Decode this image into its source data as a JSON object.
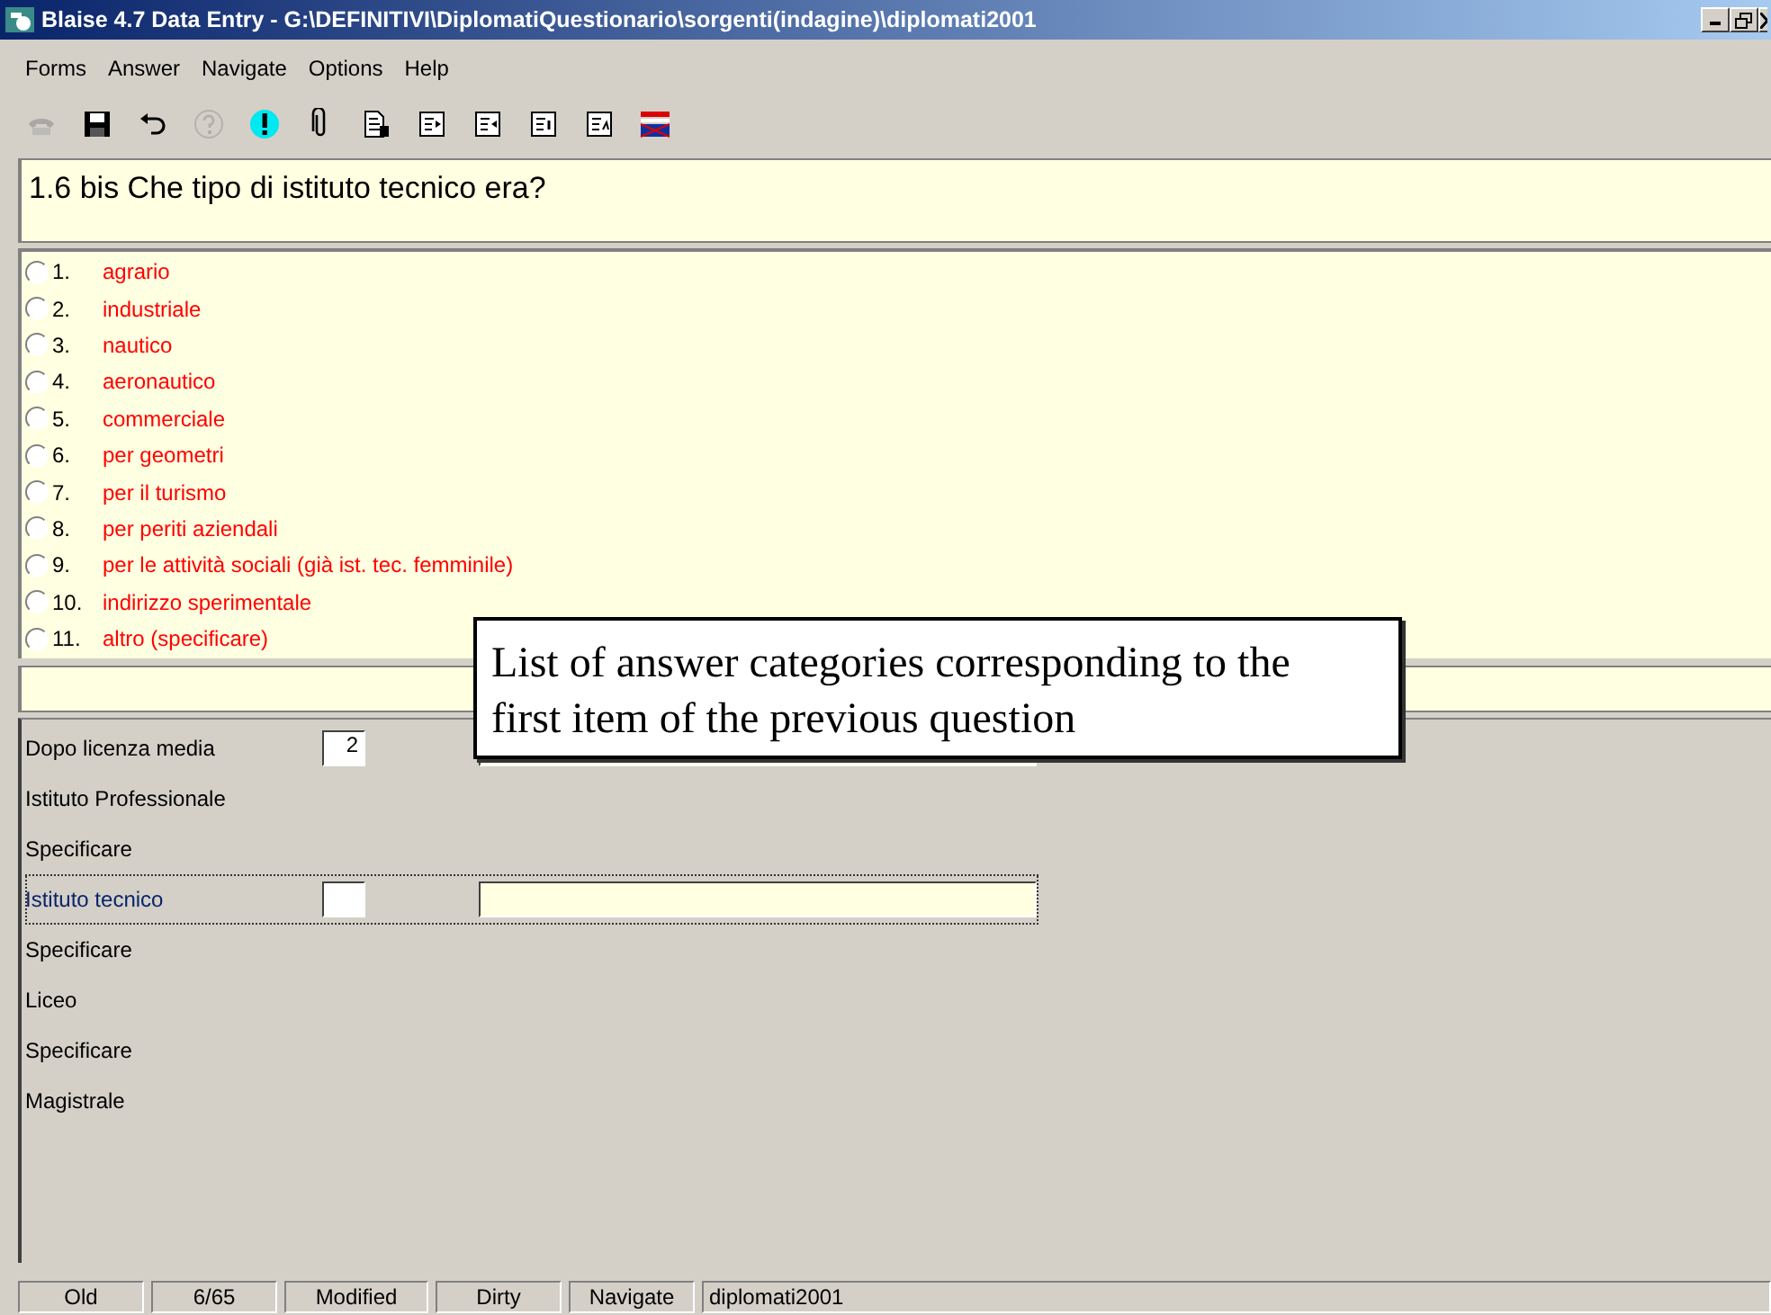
{
  "window": {
    "title": "Blaise 4.7 Data Entry - G:\\DEFINITIVI\\DiplomatiQuestionario\\sorgenti(indagine)\\diplomati2001"
  },
  "menu": [
    {
      "label": "Forms"
    },
    {
      "label": "Answer"
    },
    {
      "label": "Navigate"
    },
    {
      "label": "Options"
    },
    {
      "label": "Help"
    }
  ],
  "toolbar": [
    {
      "kind": "phone",
      "disabled": true
    },
    {
      "kind": "save",
      "disabled": false
    },
    {
      "kind": "undo",
      "disabled": false
    },
    {
      "kind": "help",
      "disabled": true
    },
    {
      "kind": "alert",
      "disabled": false
    },
    {
      "kind": "clip",
      "disabled": false
    },
    {
      "kind": "document",
      "disabled": false
    },
    {
      "kind": "page-prev",
      "disabled": false
    },
    {
      "kind": "page-next",
      "disabled": false
    },
    {
      "kind": "page-first",
      "disabled": false
    },
    {
      "kind": "page-last",
      "disabled": false
    },
    {
      "kind": "flag",
      "disabled": false
    }
  ],
  "question": "1.6 bis Che tipo di istituto tecnico era?",
  "answers": [
    {
      "number": "1.",
      "label": "agrario",
      "selected": false
    },
    {
      "number": "2.",
      "label": "industriale",
      "selected": false
    },
    {
      "number": "3.",
      "label": "nautico",
      "selected": false
    },
    {
      "number": "4.",
      "label": "aeronautico",
      "selected": false
    },
    {
      "number": "5.",
      "label": "commerciale",
      "selected": false
    },
    {
      "number": "6.",
      "label": "per geometri",
      "selected": false
    },
    {
      "number": "7.",
      "label": "per il turismo",
      "selected": false
    },
    {
      "number": "8.",
      "label": "per periti aziendali",
      "selected": false
    },
    {
      "number": "9.",
      "label": "per le attività sociali (già ist. tec. femminile)",
      "selected": false
    },
    {
      "number": "10.",
      "label": "indirizzo sperimentale",
      "selected": false
    },
    {
      "number": "11.",
      "label": "altro (specificare)",
      "selected": false
    }
  ],
  "form_fields": [
    {
      "kind": "coded",
      "label": "Dopo licenza media",
      "value": "2",
      "focused": false
    },
    {
      "kind": "heading",
      "label": "Istituto Professionale",
      "focused": false
    },
    {
      "kind": "heading",
      "label": "Specificare",
      "focused": false
    },
    {
      "kind": "coded",
      "label": "Istituto tecnico",
      "focused": true
    },
    {
      "kind": "heading",
      "label": "Specificare",
      "focused": false
    },
    {
      "kind": "heading",
      "label": "Liceo",
      "focused": false
    },
    {
      "kind": "heading",
      "label": "Specificare",
      "focused": false
    },
    {
      "kind": "heading",
      "label": "Magistrale",
      "focused": false
    }
  ],
  "callout": {
    "text": "List of answer categories corresponding to the first item of the previous question"
  },
  "status_bar": [
    "Old",
    "6/65",
    "Modified",
    "Dirty",
    "Navigate",
    "diplomati2001"
  ]
}
